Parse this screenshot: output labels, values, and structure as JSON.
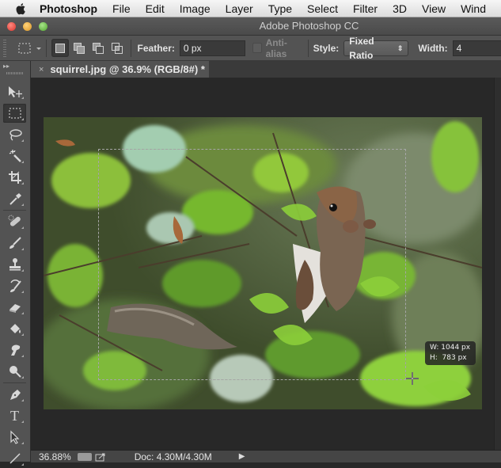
{
  "menubar": {
    "app_name": "Photoshop",
    "items": [
      "File",
      "Edit",
      "Image",
      "Layer",
      "Type",
      "Select",
      "Filter",
      "3D",
      "View",
      "Wind"
    ]
  },
  "window": {
    "title": "Adobe Photoshop CC",
    "traffic_lights": {
      "close": "#e0443e",
      "minimize": "#dea236",
      "zoom": "#65b540"
    }
  },
  "options_bar": {
    "tool_preset_icon": "rect-marquee-icon",
    "selection_modes": [
      "new-selection",
      "add-to-selection",
      "subtract-from-selection",
      "intersect-selection"
    ],
    "active_mode": "new-selection",
    "feather_label": "Feather:",
    "feather_value": "0 px",
    "antialias_label": "Anti-alias",
    "antialias_checked": false,
    "style_label": "Style:",
    "style_value": "Fixed Ratio",
    "width_label": "Width:",
    "width_value": "4"
  },
  "document_tab": {
    "close_glyph": "×",
    "title": "squirrel.jpg @ 36.9% (RGB/8#) *"
  },
  "toolbox": {
    "active_tool": "rectangular-marquee",
    "tools": [
      "move",
      "rectangular-marquee",
      "lasso",
      "magic-wand",
      "crop",
      "eyedropper",
      "spot-healing-brush",
      "brush",
      "clone-stamp",
      "history-brush",
      "eraser",
      "paint-bucket",
      "smudge",
      "dodge",
      "pen",
      "type",
      "path-selection",
      "line"
    ]
  },
  "canvas": {
    "image_subject": "gray squirrel among green leaves",
    "selection_hud": {
      "width_label": "W:",
      "width_value": "1044 px",
      "height_label": "H:",
      "height_value": "783 px"
    }
  },
  "status_bar": {
    "zoom": "36.88%",
    "doc_info": "Doc: 4.30M/4.30M",
    "arrow_glyph": "▶"
  }
}
